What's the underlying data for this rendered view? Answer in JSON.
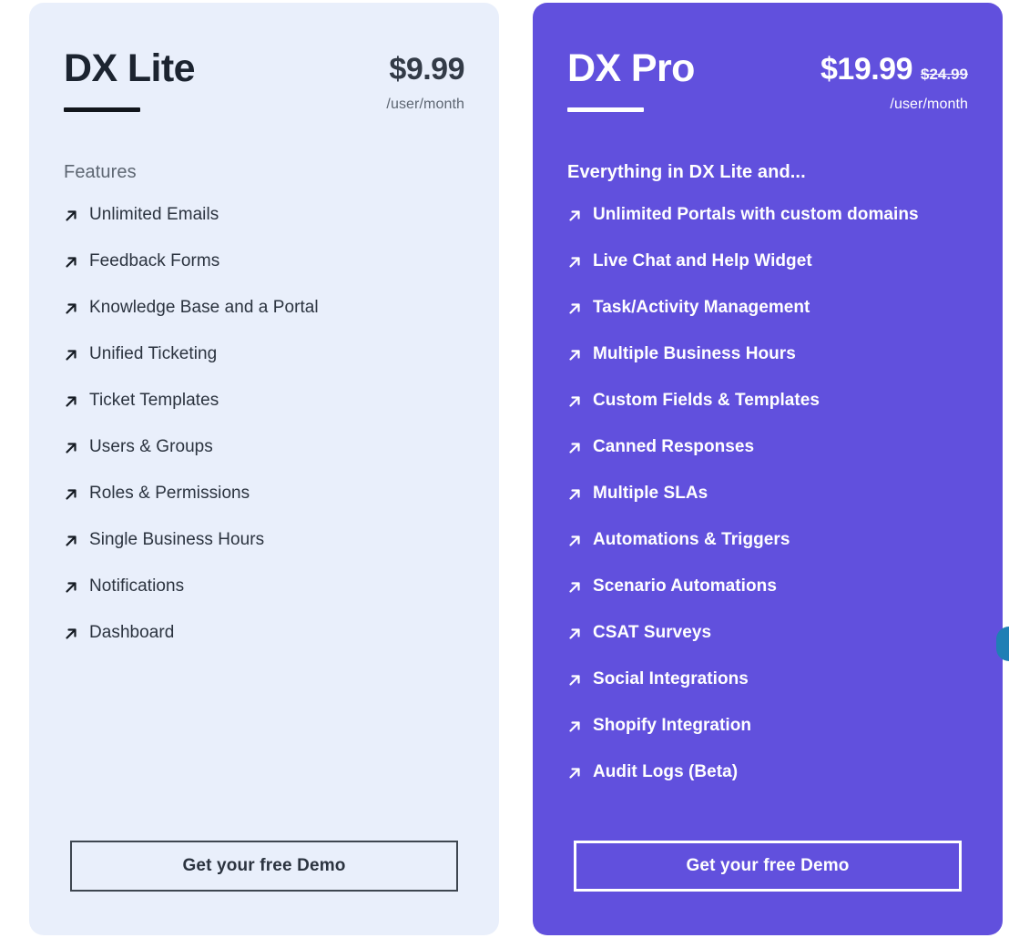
{
  "page": {
    "background_color": "#ffffff"
  },
  "plans": [
    {
      "id": "dx-lite",
      "name": "DX Lite",
      "price": "$9.99",
      "price_original": "",
      "period": "/user/month",
      "features_heading": "Features",
      "bullet_icon": "arrow-up-right-icon",
      "accent_color": "#e9effb",
      "text_color": "#2b333f",
      "cta_label": "Get your free Demo",
      "features": [
        "Unlimited Emails",
        "Feedback Forms",
        "Knowledge Base and a Portal",
        "Unified Ticketing",
        "Ticket Templates",
        "Users & Groups",
        "Roles & Permissions",
        "Single Business Hours",
        "Notifications",
        "Dashboard"
      ]
    },
    {
      "id": "dx-pro",
      "name": "DX Pro",
      "price": "$19.99",
      "price_original": "$24.99",
      "period": "/user/month",
      "features_heading": "Everything in DX Lite and...",
      "bullet_icon": "arrow-up-right-icon",
      "accent_color": "#6150dd",
      "text_color": "#ffffff",
      "cta_label": "Get your free Demo",
      "features": [
        "Unlimited Portals with custom domains",
        "Live Chat and Help Widget",
        "Task/Activity Management",
        "Multiple Business Hours",
        "Custom Fields & Templates",
        "Canned Responses",
        "Multiple SLAs",
        "Automations & Triggers",
        "Scenario Automations",
        "CSAT Surveys",
        "Social Integrations",
        "Shopify Integration",
        "Audit Logs (Beta)"
      ]
    }
  ],
  "chat_widget": {
    "icon": "chat-bubble-icon",
    "color": "#1f7fb5"
  }
}
